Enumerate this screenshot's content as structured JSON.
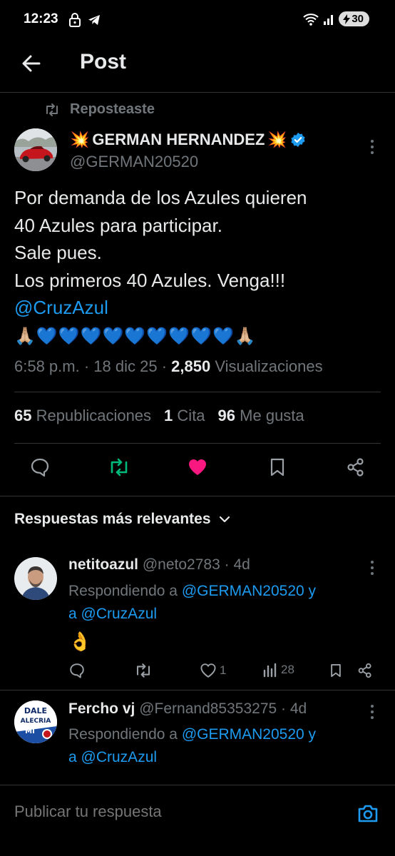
{
  "status_bar": {
    "time": "12:23",
    "battery": "30",
    "icons": [
      "lock-icon",
      "telegram-icon",
      "wifi-icon",
      "signal-icon",
      "battery-icon"
    ]
  },
  "header": {
    "title": "Post"
  },
  "repost": {
    "label": "Reposteaste"
  },
  "post": {
    "author_name": "GERMAN HERNANDEZ",
    "author_name_decoration": "💥",
    "author_handle": "@GERMAN20520",
    "verified": true,
    "text_lines": [
      "Por demanda de los Azules quieren",
      "40 Azules para participar.",
      "Sale pues.",
      "Los primeros 40 Azules. Venga!!!"
    ],
    "mention": "@CruzAzul",
    "emoji_line": "🙏🏼💙💙💙💙💙💙💙💙💙🙏🏼",
    "time": "6:58 p.m.",
    "date": "18 dic 25",
    "views_count": "2,850",
    "views_label": "Visualizaciones",
    "reposts_count": "65",
    "reposts_label": "Republicaciones",
    "quotes_count": "1",
    "quotes_label": "Cita",
    "likes_count": "96",
    "likes_label": "Me gusta",
    "liked": true,
    "reposted": true
  },
  "replies_sort": {
    "label": "Respuestas más relevantes"
  },
  "replies": [
    {
      "name": "netitoazul",
      "handle": "@neto2783",
      "age": "4d",
      "replying_prefix": "Respondiendo a",
      "replying_to_1": "@GERMAN20520",
      "replying_join": "y",
      "replying_mid": "a",
      "replying_to_2": "@CruzAzul",
      "text": "👌",
      "likes": "1",
      "views": "28"
    },
    {
      "name": "Fercho vj",
      "handle": "@Fernand85353275",
      "age": "4d",
      "replying_prefix": "Respondiendo a",
      "replying_to_1": "@GERMAN20520",
      "replying_join": "y",
      "replying_mid": "a",
      "replying_to_2": "@CruzAzul",
      "avatar_text": "DALE ALECRIA MI"
    }
  ],
  "compose": {
    "placeholder": "Publicar tu respuesta"
  },
  "colors": {
    "accent": "#1d9bf0",
    "like": "#f91880",
    "repost": "#00ba7c",
    "muted": "#71767b",
    "text": "#e7e9ea",
    "background": "#000000"
  }
}
